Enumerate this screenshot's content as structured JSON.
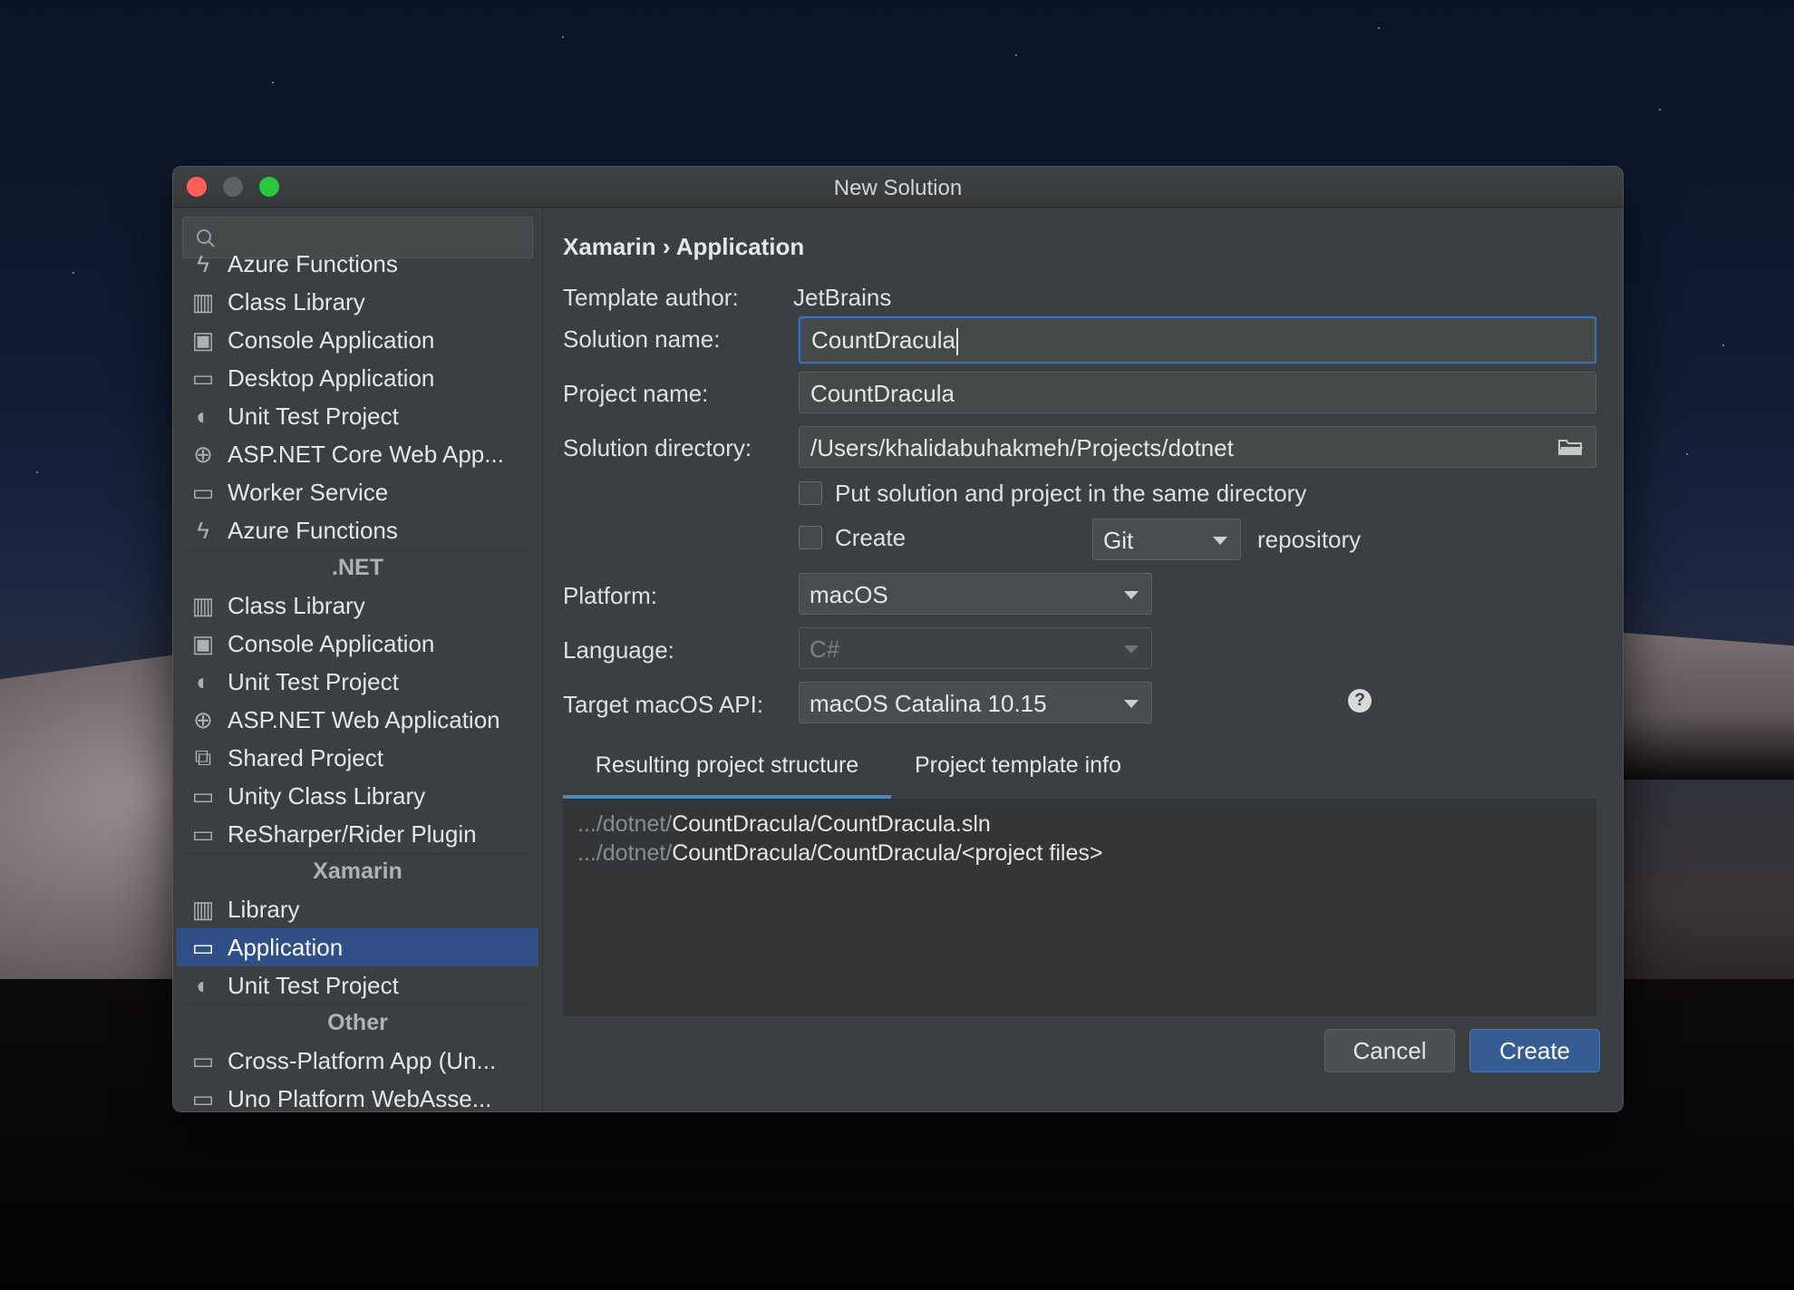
{
  "window": {
    "title": "New Solution"
  },
  "sidebar": {
    "search_placeholder": "",
    "items": [
      {
        "label": "Azure Functions",
        "icon": "azure-functions-icon"
      },
      {
        "label": "Class Library",
        "icon": "library-icon"
      },
      {
        "label": "Console Application",
        "icon": "console-icon"
      },
      {
        "label": "Desktop Application",
        "icon": "desktop-icon"
      },
      {
        "label": "Unit Test Project",
        "icon": "unit-test-icon"
      },
      {
        "label": "ASP.NET Core Web App...",
        "icon": "globe-icon"
      },
      {
        "label": "Worker Service",
        "icon": "window-icon"
      },
      {
        "label": "Azure Functions",
        "icon": "azure-functions-icon"
      }
    ],
    "group_net": ".NET",
    "net_items": [
      {
        "label": "Class Library",
        "icon": "library-icon"
      },
      {
        "label": "Console Application",
        "icon": "console-icon"
      },
      {
        "label": "Unit Test Project",
        "icon": "unit-test-icon"
      },
      {
        "label": "ASP.NET Web Application",
        "icon": "globe-icon"
      },
      {
        "label": "Shared Project",
        "icon": "shared-icon"
      },
      {
        "label": "Unity Class Library",
        "icon": "window-icon"
      },
      {
        "label": "ReSharper/Rider Plugin",
        "icon": "window-icon"
      }
    ],
    "group_xamarin": "Xamarin",
    "xamarin_items": [
      {
        "label": "Library",
        "icon": "library-icon"
      },
      {
        "label": "Application",
        "icon": "window-icon",
        "selected": true
      },
      {
        "label": "Unit Test Project",
        "icon": "unit-test-icon"
      }
    ],
    "group_other": "Other",
    "other_items": [
      {
        "label": "Cross-Platform App (Un...",
        "icon": "window-icon"
      },
      {
        "label": "Uno Platform WebAsse...",
        "icon": "window-icon"
      }
    ]
  },
  "main": {
    "breadcrumb": "Xamarin › Application",
    "template_author_label": "Template author:",
    "template_author_value": "JetBrains",
    "solution_name_label": "Solution name:",
    "solution_name_value": "CountDracula",
    "project_name_label": "Project name:",
    "project_name_value": "CountDracula",
    "solution_dir_label": "Solution directory:",
    "solution_dir_value": "/Users/khalidabuhakmeh/Projects/dotnet",
    "same_dir_label": "Put solution and project in the same directory",
    "create_label": "Create",
    "vcs_value": "Git",
    "repository_label": "repository",
    "platform_label": "Platform:",
    "platform_value": "macOS",
    "language_label": "Language:",
    "language_value": "C#",
    "target_label": "Target macOS API:",
    "target_value": "macOS Catalina 10.15",
    "help_glyph": "?",
    "tab_structure": "Resulting project structure",
    "tab_template": "Project template info",
    "structure_prefix": ".../dotnet/",
    "structure_line1": "CountDracula/CountDracula.sln",
    "structure_line2": "CountDracula/CountDracula/<project files>",
    "cancel_label": "Cancel",
    "create_button_label": "Create"
  },
  "colors": {
    "selection": "#2f4f86",
    "accent": "#365c94",
    "close": "#fe5f57",
    "maximize": "#29c840"
  }
}
